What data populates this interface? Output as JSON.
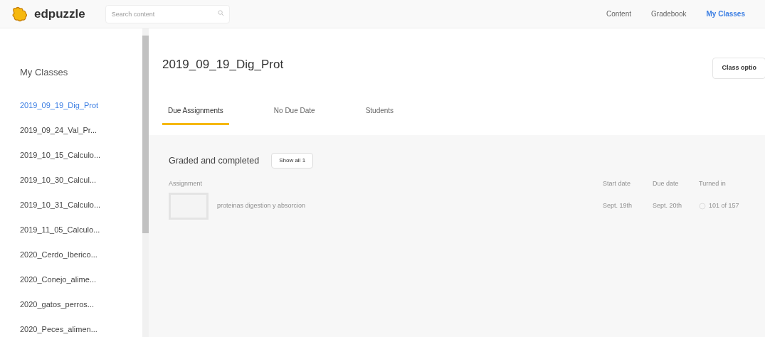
{
  "header": {
    "logo": "edpuzzle",
    "search": {
      "placeholder": "Search content"
    },
    "nav": [
      {
        "label": "Content",
        "selected": false
      },
      {
        "label": "Gradebook",
        "selected": false
      },
      {
        "label": "My Classes",
        "selected": true
      }
    ]
  },
  "sidebar": {
    "title": "My Classes",
    "items": [
      {
        "label": "2019_09_19_Dig_Prot",
        "selected": true
      },
      {
        "label": "2019_09_24_Val_Pr...",
        "selected": false
      },
      {
        "label": "2019_10_15_Calculo...",
        "selected": false
      },
      {
        "label": "2019_10_30_Calcul...",
        "selected": false
      },
      {
        "label": "2019_10_31_Calculo...",
        "selected": false
      },
      {
        "label": "2019_11_05_Calculo...",
        "selected": false
      },
      {
        "label": "2020_Cerdo_Iberico...",
        "selected": false
      },
      {
        "label": "2020_Conejo_alime...",
        "selected": false
      },
      {
        "label": "2020_gatos_perros...",
        "selected": false
      },
      {
        "label": "2020_Peces_alimen...",
        "selected": false
      }
    ]
  },
  "main": {
    "title": "2019_09_19_Dig_Prot",
    "class_options": "Class optio",
    "tabs": [
      {
        "label": "Due Assignments",
        "selected": true
      },
      {
        "label": "No Due Date",
        "selected": false
      },
      {
        "label": "Students",
        "selected": false
      }
    ],
    "section": {
      "title": "Graded and completed",
      "show_all": "Show all 1",
      "columns": [
        "Assignment",
        "Start date",
        "Due date",
        "Turned in"
      ],
      "rows": [
        {
          "assignment": "proteinas digestion y absorcion",
          "start_date": "Sept. 19th",
          "due_date": "Sept. 20th",
          "turned_in": "101 of 157"
        }
      ]
    }
  }
}
